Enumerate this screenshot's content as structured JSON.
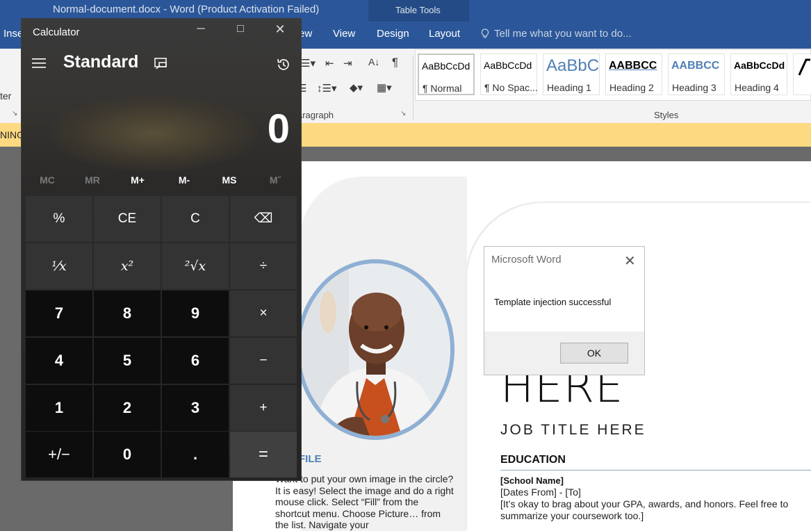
{
  "word": {
    "window_title": "Normal-document.docx - Word (Product Activation Failed)",
    "table_tools": "Table Tools",
    "tabs": [
      "Inse",
      "ew",
      "View",
      "Design",
      "Layout"
    ],
    "tell_me": "Tell me what you want to do...",
    "ribbon": {
      "left_fragment": "ter",
      "paragraph_label": "aragraph",
      "styles_label": "Styles",
      "styles": [
        {
          "sample": "AaBbCcDd",
          "name": "¶ Normal"
        },
        {
          "sample": "AaBbCcDd",
          "name": "¶ No Spac..."
        },
        {
          "sample": "AaBbC",
          "name": "Heading 1"
        },
        {
          "sample": "AABBCC",
          "name": "Heading 2"
        },
        {
          "sample": "AABBCC",
          "name": "Heading 3"
        },
        {
          "sample": "AaBbCcDd",
          "name": "Heading 4"
        }
      ]
    },
    "warning_fragment": "NING",
    "document": {
      "profile_heading": "FILE",
      "profile_text": "Want to put your own image in the circle?  It is easy!  Select the image and do a right mouse click.  Select “Fill” from the shortcut menu.  Choose Picture… from the list.  Navigate your",
      "name": "HERE",
      "job_title": "JOB TITLE HERE",
      "education_heading": "EDUCATION",
      "school": "[School Name]",
      "dates": "[Dates From] - [To]",
      "gpa": "[It’s okay to brag about your GPA, awards, and honors. Feel free to summarize your coursework too.]"
    }
  },
  "dialog": {
    "title": "Microsoft Word",
    "message": "Template injection successful",
    "ok": "OK"
  },
  "calculator": {
    "title": "Calculator",
    "mode": "Standard",
    "display": "0",
    "memory": [
      "MC",
      "MR",
      "M+",
      "M-",
      "MS",
      "Mˇ"
    ],
    "keys": [
      "%",
      "CE",
      "C",
      "⌫",
      "⅟x",
      "x²",
      "²√x",
      "÷",
      "7",
      "8",
      "9",
      "×",
      "4",
      "5",
      "6",
      "−",
      "1",
      "2",
      "3",
      "+",
      "+/−",
      "0",
      ".",
      "="
    ]
  },
  "colors": {
    "word_blue": "#2b579a",
    "warning_yellow": "#fdd981",
    "accent_blue": "#4f7fb5"
  }
}
